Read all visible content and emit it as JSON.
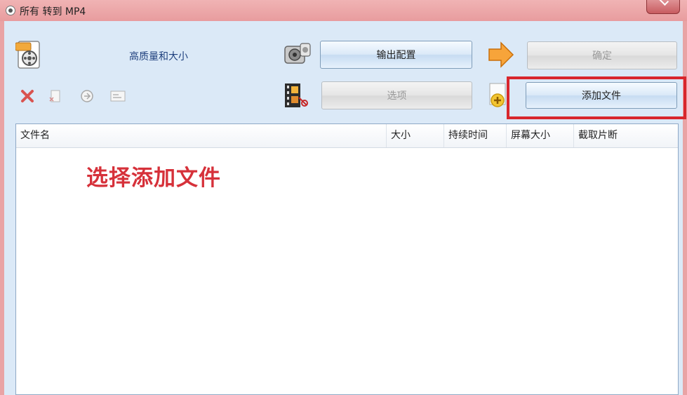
{
  "window": {
    "title": "所有 转到 MP4"
  },
  "toolbar": {
    "profile_label": "高质量和大小",
    "output_config_label": "输出配置",
    "ok_label": "确定",
    "options_label": "选项",
    "add_file_label": "添加文件"
  },
  "file_table": {
    "columns": [
      "文件名",
      "大小",
      "持续时间",
      "屏幕大小",
      "截取片断"
    ],
    "rows": []
  },
  "annotation": {
    "text": "选择添加文件",
    "color": "#d6313a"
  },
  "colors": {
    "highlight": "#d8262c",
    "titlebar": "#e89c9e",
    "client_bg": "#dbe9f7"
  }
}
